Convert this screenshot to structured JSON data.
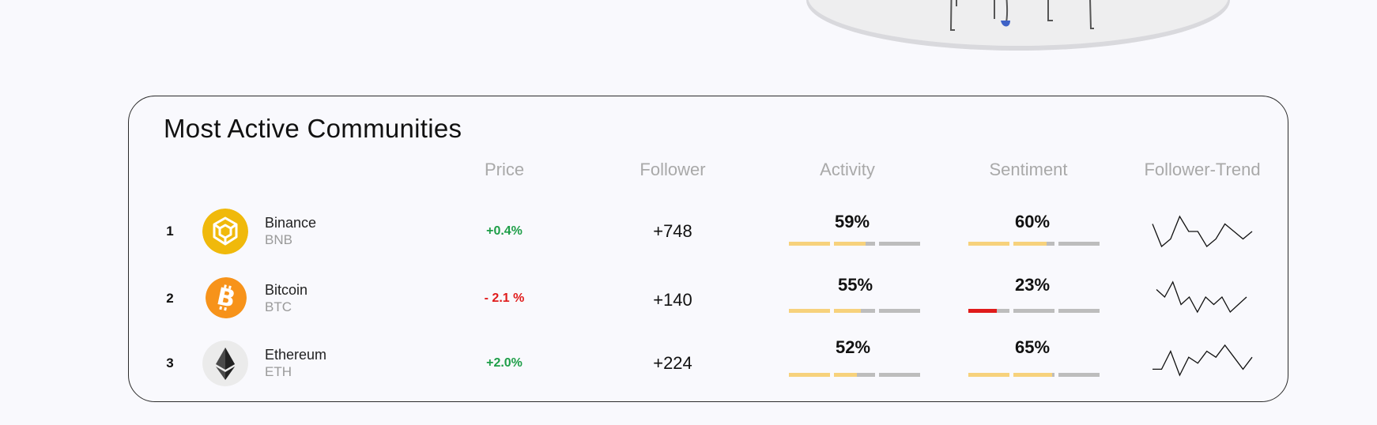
{
  "title": "Most Active Communities",
  "headers": {
    "price": "Price",
    "follower": "Follower",
    "activity": "Activity",
    "sentiment": "Sentiment",
    "trend": "Follower-Trend"
  },
  "colors": {
    "up": "#1e9e48",
    "down": "#e01b1b",
    "bar_fill": "#f7d27c",
    "bar_low": "#e01b1b",
    "bar_empty": "#bdbdbd"
  },
  "rows": [
    {
      "rank": "1",
      "name": "Binance",
      "symbol": "BNB",
      "icon": "binance-icon",
      "price": "+0.4%",
      "price_dir": "up",
      "follower": "+748",
      "activity": "59%",
      "activity_value": 0.59,
      "sentiment": "60%",
      "sentiment_value": 0.6,
      "trend": [
        4,
        1,
        2,
        5,
        3,
        3,
        1,
        2,
        4,
        3,
        2,
        3
      ]
    },
    {
      "rank": "2",
      "name": "Bitcoin",
      "symbol": "BTC",
      "icon": "bitcoin-icon",
      "price": "- 2.1 %",
      "price_dir": "down",
      "follower": "+140",
      "activity": "55%",
      "activity_value": 0.55,
      "sentiment": "23%",
      "sentiment_value": 0.23,
      "trend": [
        4,
        3,
        5,
        2,
        3,
        1,
        3,
        2,
        3,
        1,
        2,
        3
      ]
    },
    {
      "rank": "3",
      "name": "Ethereum",
      "symbol": "ETH",
      "icon": "ethereum-icon",
      "price": "+2.0%",
      "price_dir": "up",
      "follower": "+224",
      "activity": "52%",
      "activity_value": 0.52,
      "sentiment": "65%",
      "sentiment_value": 0.65,
      "trend": [
        1,
        1,
        4,
        0,
        3,
        2,
        4,
        3,
        5,
        3,
        1,
        3
      ]
    }
  ]
}
